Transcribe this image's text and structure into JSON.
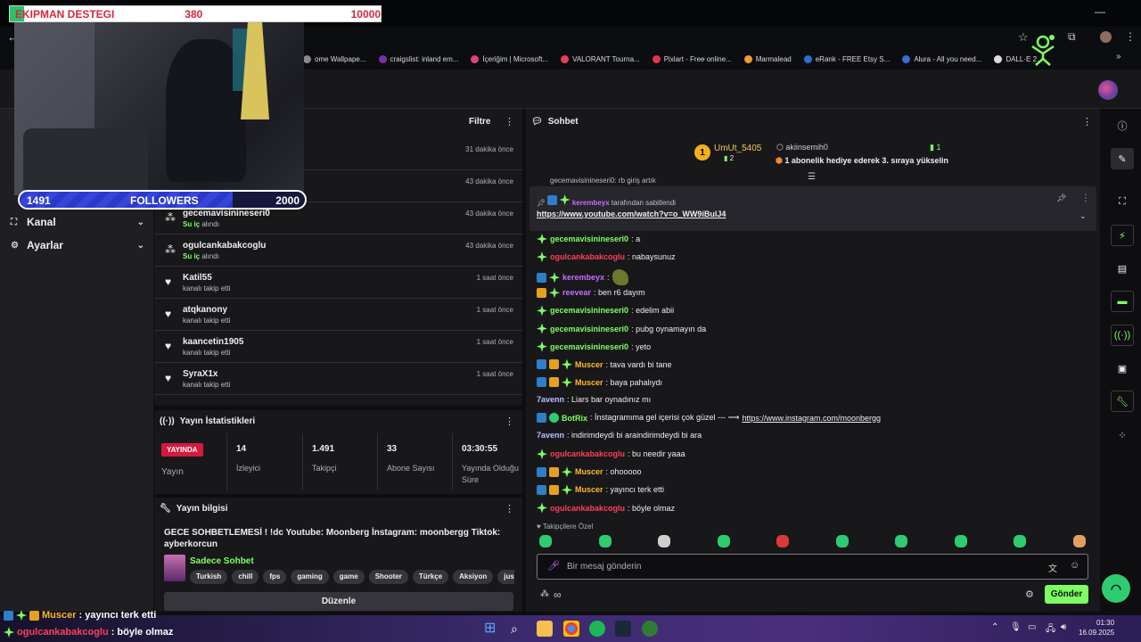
{
  "overlay": {
    "alert_title": "EKIPMAN DESTEGI",
    "alert_current": "380",
    "alert_goal": "10000",
    "alert_progress": 0.038,
    "followers_current": "1491",
    "followers_label": "FOLLOWERS",
    "followers_goal": "2000",
    "followers_progress": 0.7455
  },
  "bookmarks": [
    {
      "label": "ome Wallpape...",
      "color": "#888888"
    },
    {
      "label": "craigslist: inland em...",
      "color": "#7b2fa8"
    },
    {
      "label": "İçeriğim | Microsoft...",
      "color": "#e0437b"
    },
    {
      "label": "VALORANT Tourna...",
      "color": "#e84057"
    },
    {
      "label": "Pixlart - Free online...",
      "color": "#e8334f"
    },
    {
      "label": "Marmalead",
      "color": "#f29b30"
    },
    {
      "label": "eRank - FREE Etsy S...",
      "color": "#2a6fd1"
    },
    {
      "label": "Alura - All you need...",
      "color": "#3e6ad6"
    },
    {
      "label": "DALL·E 2",
      "color": "#dcdcdc"
    }
  ],
  "nav": {
    "items": [
      {
        "label": "Kanal"
      },
      {
        "label": "Ayarlar"
      }
    ]
  },
  "activity": {
    "filter_label": "Filtre",
    "rows": [
      {
        "name": "",
        "sub_bold": "",
        "sub": "",
        "time": "31 dakika önce"
      },
      {
        "name": "",
        "sub_bold": "",
        "sub": "",
        "time": "43 dakika önce"
      },
      {
        "name": "gecemavisinineseri0",
        "sub_bold": "Su iç",
        "sub": " alındı",
        "time": "43 dakika önce"
      },
      {
        "name": "ogulcankabakcoglu",
        "sub_bold": "Su iç",
        "sub": " alındı",
        "time": "43 dakika önce"
      },
      {
        "name": "Katil55",
        "sub_bold": "",
        "sub": "kanalı takip etti",
        "time": "1 saat önce"
      },
      {
        "name": "atqkanony",
        "sub_bold": "",
        "sub": "kanalı takip etti",
        "time": "1 saat önce"
      },
      {
        "name": "kaancetin1905",
        "sub_bold": "",
        "sub": "kanalı takip etti",
        "time": "1 saat önce"
      },
      {
        "name": "SyraX1x",
        "sub_bold": "",
        "sub": "kanalı takip etti",
        "time": "1 saat önce"
      }
    ]
  },
  "stats": {
    "title": "Yayın İstatistikleri",
    "live_badge": "YAYINDA",
    "live_sub": "Yayın",
    "items": [
      {
        "value": "14",
        "label": "İzleyici"
      },
      {
        "value": "1.491",
        "label": "Takipçi"
      },
      {
        "value": "33",
        "label": "Abone Sayısı"
      },
      {
        "value": "03:30:55",
        "label": "Yayında Olduğu Süre"
      }
    ]
  },
  "stream_info": {
    "title": "Yayın bilgisi",
    "stream_title": "GECE SOHBETLEMESİ ! !dc Youtube: Moonberg İnstagram: moonbergg Tiktok: ayberkorcun",
    "category": "Sadece Sohbet",
    "tags": [
      "Turkish",
      "chill",
      "fps",
      "gaming",
      "game",
      "Shooter",
      "Türkçe",
      "Aksiyon",
      "justchattin"
    ],
    "edit_label": "Düzenle"
  },
  "chat": {
    "title": "Sohbet",
    "leaderboard": {
      "first_rank": "1",
      "first_name": "UmUt_5405",
      "first_count": "2",
      "second_name": "akiinsemih0",
      "second_count": "1",
      "second_event": "1 abonelik hediye ederek 3. sıraya yükselin"
    },
    "partial_line": "gecemavisinineseri0: rb giriş artık",
    "pinned_by_user": "kerembeyx",
    "pinned_by_text": " tarafından sabitlendi",
    "pinned_link": "https://www.youtube.com/watch?v=o_WW9iBulJ4",
    "messages": [
      {
        "badges": [
          "star"
        ],
        "user": "gecemavisinineseri0",
        "color": "green",
        "text": ": a"
      },
      {
        "badges": [
          "star"
        ],
        "user": "ogulcankabakcoglu",
        "color": "red",
        "text": ": nabaysunuz"
      },
      {
        "badges": [
          "sub",
          "star"
        ],
        "user": "kerembeyx",
        "color": "purple",
        "text": ":",
        "emote": true
      },
      {
        "badges": [
          "vip",
          "star"
        ],
        "user": "reevear",
        "color": "purple",
        "text": ": ben r6 dayım"
      },
      {
        "badges": [
          "star"
        ],
        "user": "gecemavisinineseri0",
        "color": "green",
        "text": ": edelim abii"
      },
      {
        "badges": [
          "star"
        ],
        "user": "gecemavisinineseri0",
        "color": "green",
        "text": ": pubg oynamayın da"
      },
      {
        "badges": [
          "star"
        ],
        "user": "gecemavisinineseri0",
        "color": "green",
        "text": ": yeto"
      },
      {
        "badges": [
          "sub",
          "vip",
          "star"
        ],
        "user": "Muscer",
        "color": "gold",
        "text": ": tava vardı bi tane"
      },
      {
        "badges": [
          "sub",
          "vip",
          "star"
        ],
        "user": "Muscer",
        "color": "gold",
        "text": ": baya pahalıydı"
      },
      {
        "badges": [],
        "user": "7avenn",
        "color": "cyan",
        "text": ": Liars bar oynadınız mı"
      },
      {
        "badges": [
          "sub",
          "mod"
        ],
        "user": "BotRix",
        "color": "green",
        "text": ": İnstagramıma gel içerisi çok güzel --- ⟶ ",
        "link": "https://www.instagram.com/moonbergg"
      },
      {
        "badges": [],
        "user": "7avenn",
        "color": "cyan",
        "text": ": indirimdeydi bi araindirimdeydi bi ara"
      },
      {
        "badges": [
          "star"
        ],
        "user": "ogulcankabakcoglu",
        "color": "red",
        "text": ": bu needir yaaa"
      },
      {
        "badges": [
          "sub",
          "vip",
          "star"
        ],
        "user": "Muscer",
        "color": "gold",
        "text": ": ohooooo"
      },
      {
        "badges": [
          "sub",
          "vip",
          "star"
        ],
        "user": "Muscer",
        "color": "gold",
        "text": ": yayıncı terk etti"
      },
      {
        "badges": [
          "star"
        ],
        "user": "ogulcankabakcoglu",
        "color": "red",
        "text": ": böyle olmaz"
      }
    ],
    "followers_only": "Takipçilere Özel",
    "input_placeholder": "Bir mesaj gönderin",
    "send_label": "Gönder"
  },
  "overlay_chat": [
    {
      "user": "Muscer",
      "color": "#ffb82b",
      "text": " : yayıncı terk etti"
    },
    {
      "user": "ogulcankabakcoglu",
      "color": "#ff3f5b",
      "text": " : böyle olmaz"
    }
  ],
  "taskbar": {
    "time": "01:30",
    "date": "16.09.2025"
  }
}
